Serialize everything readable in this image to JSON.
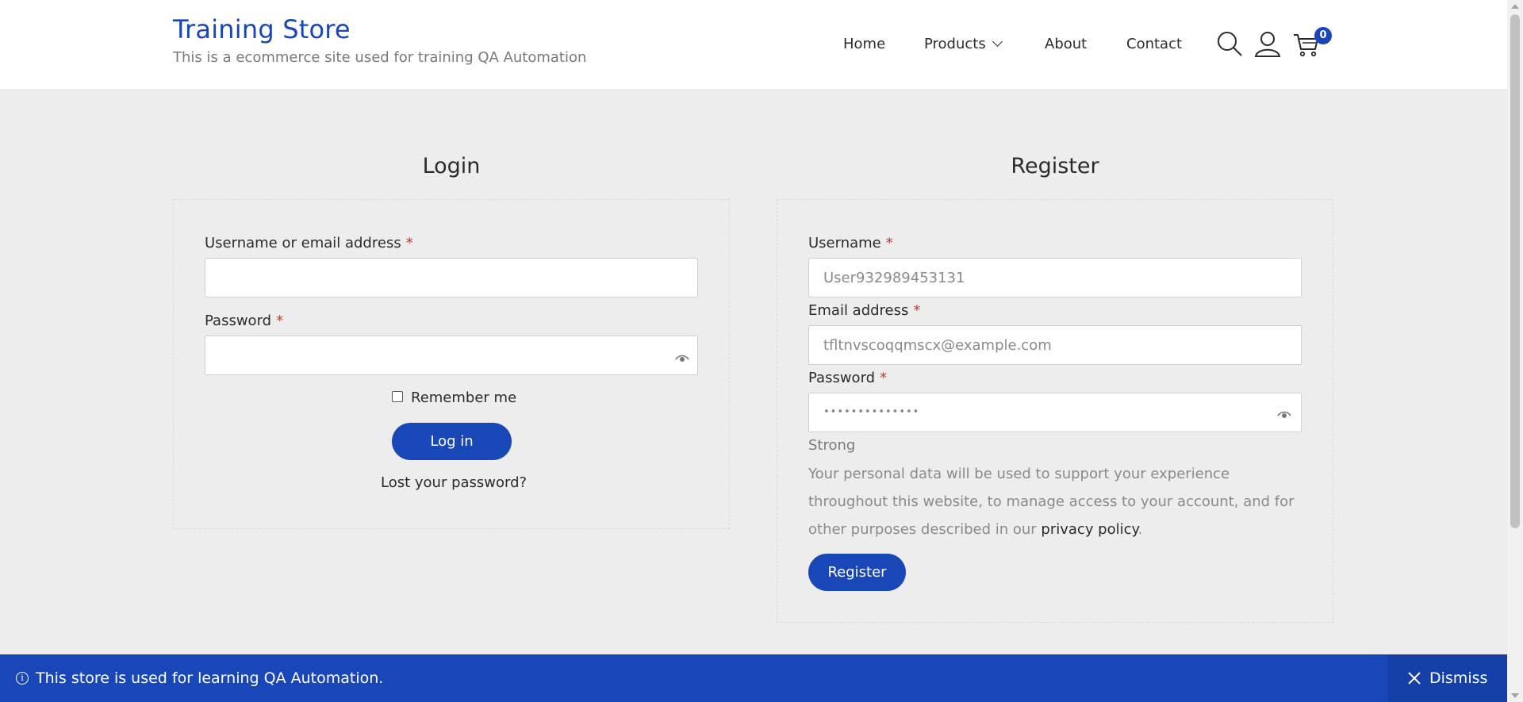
{
  "header": {
    "brand_title": "Training Store",
    "brand_tagline": "This is a ecommerce site used for training QA Automation",
    "nav": {
      "home": "Home",
      "products": "Products",
      "about": "About",
      "contact": "Contact"
    },
    "cart_count": "0",
    "icons": [
      "search-icon",
      "user-icon",
      "cart-icon",
      "chevron-down-icon"
    ]
  },
  "login": {
    "title": "Login",
    "username_label": "Username or email address",
    "username_value": "",
    "password_label": "Password",
    "password_value": "",
    "required_mark": "*",
    "remember_label": "Remember me",
    "remember_checked": false,
    "submit_label": "Log in",
    "lost_password": "Lost your password?"
  },
  "register": {
    "title": "Register",
    "username_label": "Username",
    "username_value": "User932989453131",
    "email_label": "Email address",
    "email_value": "tfltnvscoqqmscx@example.com",
    "password_label": "Password",
    "password_masked": "••••••••••••••",
    "required_mark": "*",
    "strength": "Strong",
    "privacy_text_before": "Your personal data will be used to support your experience throughout this website, to manage access to your account, and for other purposes described in our ",
    "privacy_link": "privacy policy",
    "privacy_text_after": ".",
    "submit_label": "Register"
  },
  "notice": {
    "text": "This store is used for learning QA Automation.",
    "dismiss_label": "Dismiss"
  },
  "colors": {
    "accent": "#1a47b8",
    "background": "#ededed",
    "required": "#c0392b"
  }
}
